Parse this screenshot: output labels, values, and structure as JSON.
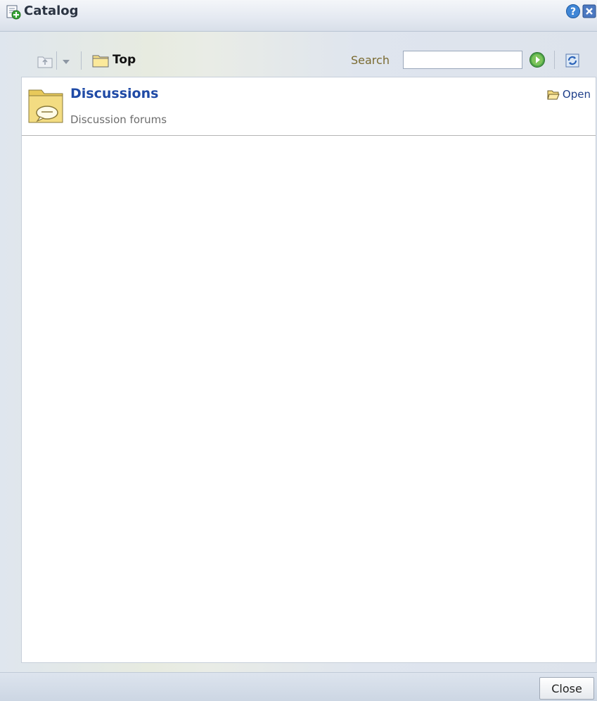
{
  "window": {
    "title": "Catalog"
  },
  "toolbar": {
    "breadcrumb_current": "Top",
    "search_label": "Search",
    "search_value": ""
  },
  "items": [
    {
      "title": "Discussions",
      "description": "Discussion forums",
      "action_label": "Open"
    }
  ],
  "footer": {
    "close_label": "Close"
  },
  "icons": {
    "title": "catalog-add-icon",
    "help": "help-icon",
    "close": "close-x-icon",
    "up": "folder-up-icon",
    "dropdown": "dropdown-arrow-icon",
    "breadcrumb": "folder-icon",
    "go": "go-arrow-icon",
    "refresh": "refresh-icon",
    "item": "discussion-folder-icon",
    "open": "open-folder-icon"
  },
  "colors": {
    "link": "#1f4aa6",
    "search_label": "#7a6a30",
    "title_text": "#2b3442"
  }
}
